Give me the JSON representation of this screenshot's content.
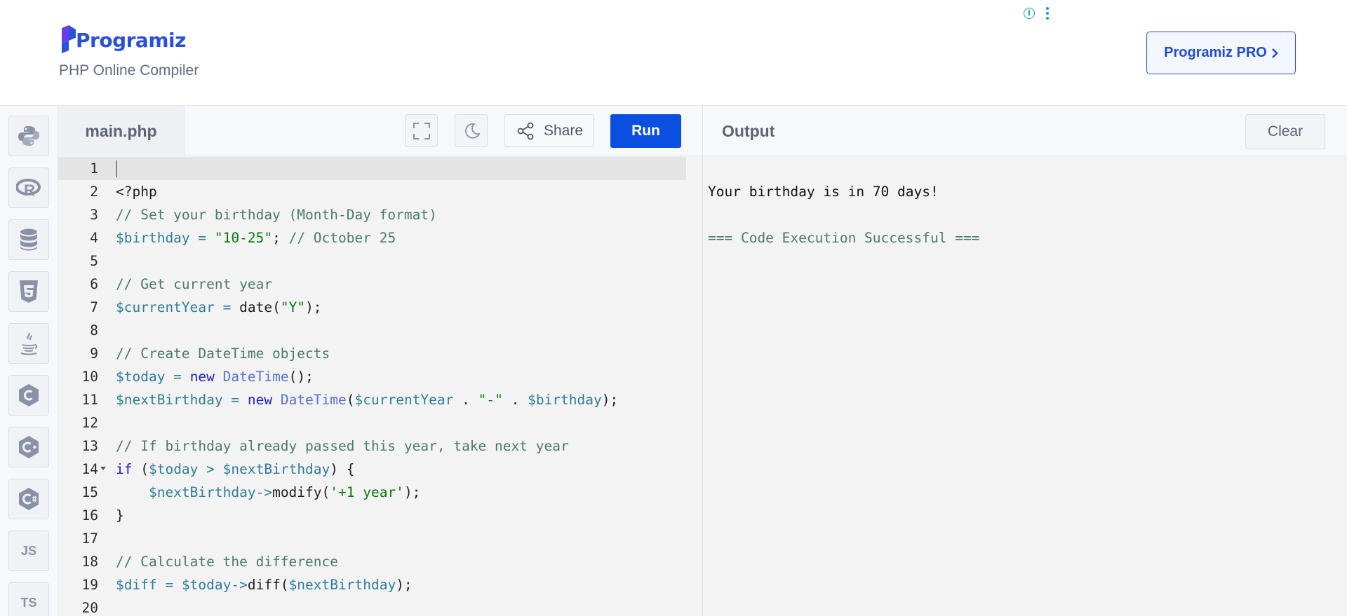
{
  "header": {
    "logo_text": "Programiz",
    "subtitle": "PHP Online Compiler",
    "pro_button": "Programiz PRO"
  },
  "sidebar": {
    "languages": [
      {
        "name": "python-icon"
      },
      {
        "name": "r-icon"
      },
      {
        "name": "sql-icon"
      },
      {
        "name": "html-icon"
      },
      {
        "name": "java-icon"
      },
      {
        "name": "c-icon"
      },
      {
        "name": "cpp-icon"
      },
      {
        "name": "csharp-icon"
      },
      {
        "name": "js-icon",
        "label": "JS"
      },
      {
        "name": "ts-icon",
        "label": "TS"
      }
    ]
  },
  "editor": {
    "filename": "main.php",
    "share_label": "Share",
    "run_label": "Run",
    "lines": [
      {
        "n": "1",
        "segs": []
      },
      {
        "n": "2",
        "segs": [
          {
            "t": "<?php",
            "c": "plain"
          }
        ]
      },
      {
        "n": "3",
        "segs": [
          {
            "t": "// Set your birthday (Month-Day format)",
            "c": "cm"
          }
        ]
      },
      {
        "n": "4",
        "segs": [
          {
            "t": "$birthday",
            "c": "var"
          },
          {
            "t": " = ",
            "c": "var"
          },
          {
            "t": "\"10-25\"",
            "c": "str"
          },
          {
            "t": "; ",
            "c": "plain"
          },
          {
            "t": "// October 25",
            "c": "cm"
          }
        ]
      },
      {
        "n": "5",
        "segs": []
      },
      {
        "n": "6",
        "segs": [
          {
            "t": "// Get current year",
            "c": "cm"
          }
        ]
      },
      {
        "n": "7",
        "segs": [
          {
            "t": "$currentYear",
            "c": "var"
          },
          {
            "t": " = ",
            "c": "var"
          },
          {
            "t": "date(",
            "c": "plain"
          },
          {
            "t": "\"Y\"",
            "c": "str"
          },
          {
            "t": ");",
            "c": "plain"
          }
        ]
      },
      {
        "n": "8",
        "segs": []
      },
      {
        "n": "9",
        "segs": [
          {
            "t": "// Create DateTime objects",
            "c": "cm"
          }
        ]
      },
      {
        "n": "10",
        "segs": [
          {
            "t": "$today",
            "c": "var"
          },
          {
            "t": " = ",
            "c": "var"
          },
          {
            "t": "new",
            "c": "kw"
          },
          {
            "t": " ",
            "c": "plain"
          },
          {
            "t": "DateTime",
            "c": "cls"
          },
          {
            "t": "();",
            "c": "plain"
          }
        ]
      },
      {
        "n": "11",
        "segs": [
          {
            "t": "$nextBirthday",
            "c": "var"
          },
          {
            "t": " = ",
            "c": "var"
          },
          {
            "t": "new",
            "c": "kw"
          },
          {
            "t": " ",
            "c": "plain"
          },
          {
            "t": "DateTime",
            "c": "cls"
          },
          {
            "t": "(",
            "c": "plain"
          },
          {
            "t": "$currentYear",
            "c": "var"
          },
          {
            "t": " . ",
            "c": "plain"
          },
          {
            "t": "\"-\"",
            "c": "str"
          },
          {
            "t": " . ",
            "c": "plain"
          },
          {
            "t": "$birthday",
            "c": "var"
          },
          {
            "t": ");",
            "c": "plain"
          }
        ]
      },
      {
        "n": "12",
        "segs": []
      },
      {
        "n": "13",
        "segs": [
          {
            "t": "// If birthday already passed this year, take next year",
            "c": "cm"
          }
        ]
      },
      {
        "n": "14",
        "fold": true,
        "segs": [
          {
            "t": "if",
            "c": "kw"
          },
          {
            "t": " (",
            "c": "plain"
          },
          {
            "t": "$today",
            "c": "var"
          },
          {
            "t": " > ",
            "c": "var"
          },
          {
            "t": "$nextBirthday",
            "c": "var"
          },
          {
            "t": ") {",
            "c": "plain"
          }
        ]
      },
      {
        "n": "15",
        "segs": [
          {
            "t": "    ",
            "c": "plain"
          },
          {
            "t": "$nextBirthday->",
            "c": "var"
          },
          {
            "t": "modify(",
            "c": "plain"
          },
          {
            "t": "'+1 year'",
            "c": "str"
          },
          {
            "t": ");",
            "c": "plain"
          }
        ]
      },
      {
        "n": "16",
        "segs": [
          {
            "t": "}",
            "c": "plain"
          }
        ]
      },
      {
        "n": "17",
        "segs": []
      },
      {
        "n": "18",
        "segs": [
          {
            "t": "// Calculate the difference",
            "c": "cm"
          }
        ]
      },
      {
        "n": "19",
        "segs": [
          {
            "t": "$diff",
            "c": "var"
          },
          {
            "t": " = ",
            "c": "var"
          },
          {
            "t": "$today->",
            "c": "var"
          },
          {
            "t": "diff(",
            "c": "plain"
          },
          {
            "t": "$nextBirthday",
            "c": "var"
          },
          {
            "t": ");",
            "c": "plain"
          }
        ]
      },
      {
        "n": "20",
        "segs": []
      }
    ]
  },
  "output": {
    "title": "Output",
    "clear_label": "Clear",
    "lines": [
      {
        "text": "",
        "kind": "normal"
      },
      {
        "text": "Your birthday is in 70 days!",
        "kind": "normal"
      },
      {
        "text": "",
        "kind": "normal"
      },
      {
        "text": "=== Code Execution Successful ===",
        "kind": "success"
      }
    ]
  },
  "colors": {
    "brand": "#2a52d8",
    "run_button": "#0a4fe0",
    "comment": "#4a7c68",
    "variable": "#2e7d9a",
    "string": "#0a7a0a",
    "keyword": "#1b1bd1",
    "class": "#5b6fd6"
  }
}
